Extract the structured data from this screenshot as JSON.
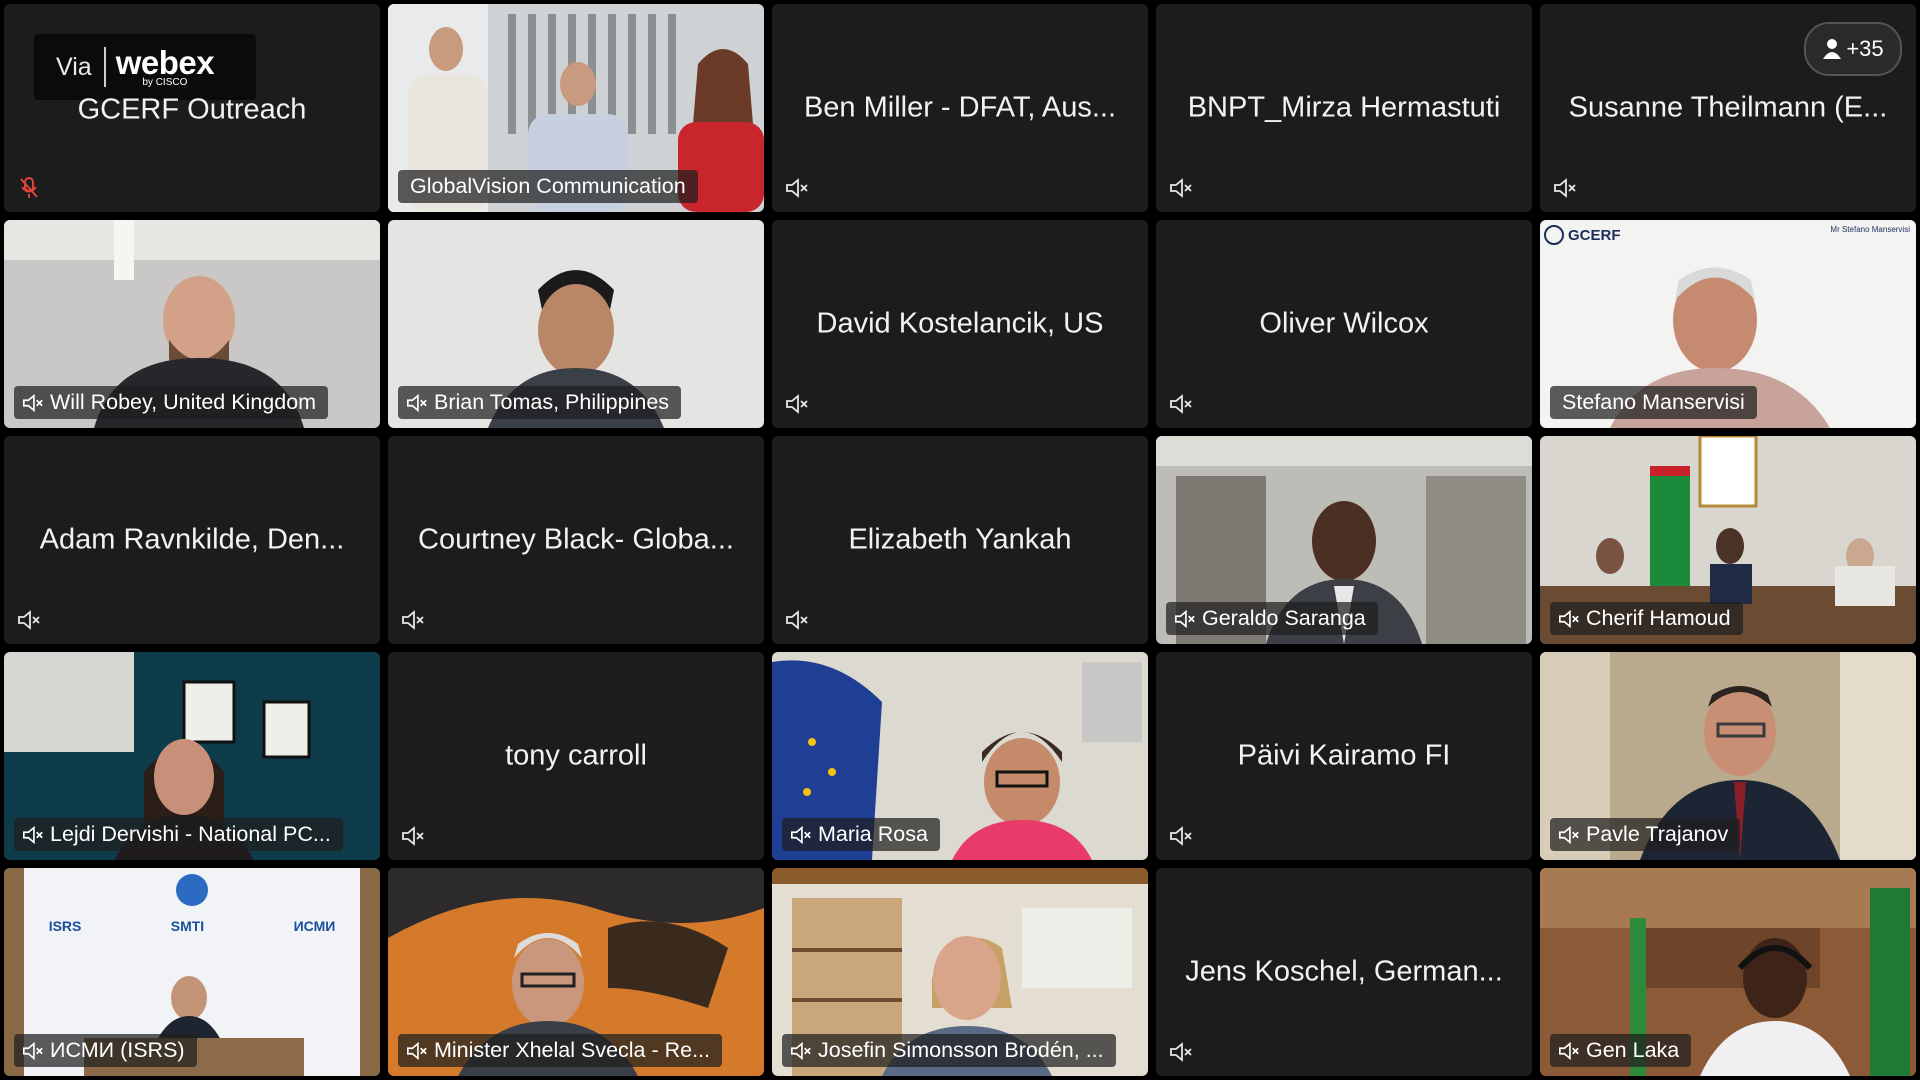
{
  "app": {
    "brand_via": "Via",
    "brand_name": "webex",
    "brand_by": "by CISCO"
  },
  "participant_count": "+35",
  "tiles": [
    {
      "name": "GCERF Outreach"
    },
    {
      "name": "GlobalVision Communication"
    },
    {
      "name": "Ben Miller - DFAT, Aus..."
    },
    {
      "name": "BNPT_Mirza Hermastuti"
    },
    {
      "name": "Susanne Theilmann (E..."
    },
    {
      "name": "Will Robey, United Kingdom"
    },
    {
      "name": "Brian Tomas, Philippines"
    },
    {
      "name": "David Kostelancik, US"
    },
    {
      "name": "Oliver Wilcox"
    },
    {
      "name": "Stefano Manservisi"
    },
    {
      "name": "Adam Ravnkilde, Den..."
    },
    {
      "name": "Courtney Black- Globa..."
    },
    {
      "name": "Elizabeth Yankah"
    },
    {
      "name": "Geraldo Saranga"
    },
    {
      "name": "Cherif Hamoud"
    },
    {
      "name": "Lejdi Dervishi - National PC..."
    },
    {
      "name": "tony carroll"
    },
    {
      "name": "Maria Rosa"
    },
    {
      "name": "Päivi Kairamo FI"
    },
    {
      "name": "Pavle Trajanov"
    },
    {
      "name": "ИСМИ (ISRS)"
    },
    {
      "name": "Minister Xhelal Svecla - Re..."
    },
    {
      "name": "Josefin Simonsson Brodén, ..."
    },
    {
      "name": "Jens Koschel, German..."
    },
    {
      "name": "Gen Laka"
    }
  ],
  "backdrops": {
    "gcerf_logo": "GCERF",
    "gcerf_caption": "Mr Stefano Manservisi",
    "isrs_left": "ISRS",
    "isrs_mid": "SMTI",
    "isrs_right": "ИСМИ"
  }
}
